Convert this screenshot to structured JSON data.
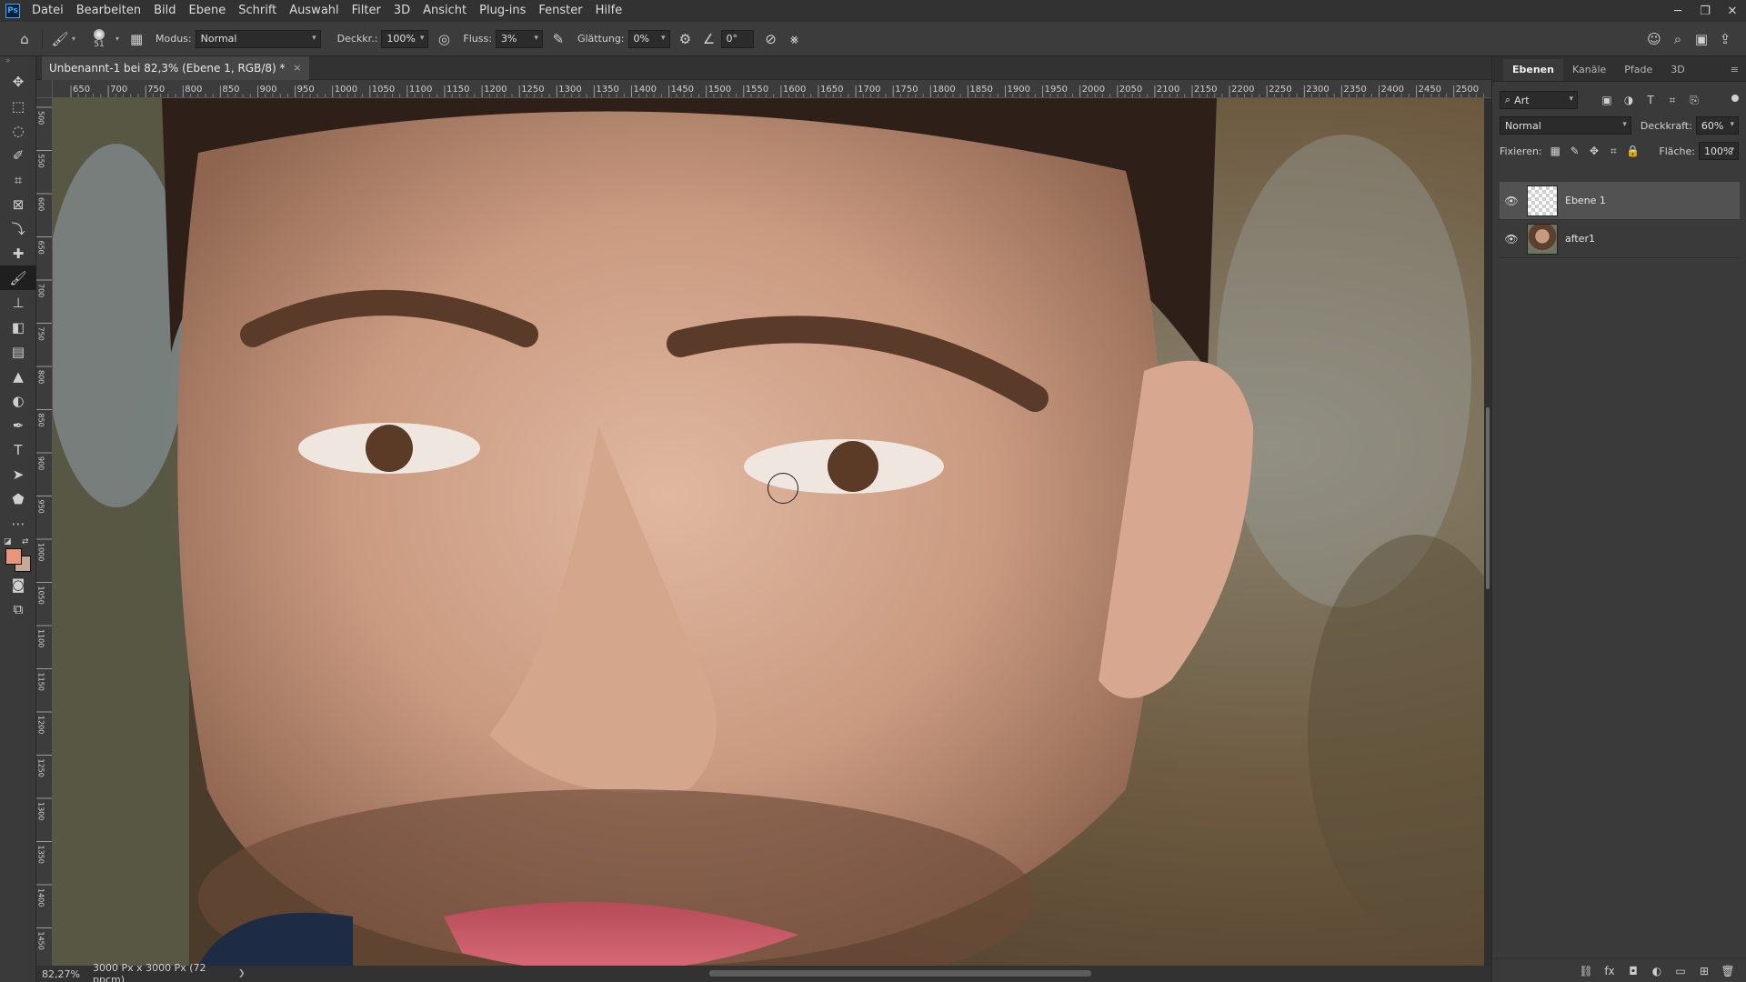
{
  "app": {
    "logo": "Ps",
    "menu": [
      "Datei",
      "Bearbeiten",
      "Bild",
      "Ebene",
      "Schrift",
      "Auswahl",
      "Filter",
      "3D",
      "Ansicht",
      "Plug-ins",
      "Fenster",
      "Hilfe"
    ],
    "window_controls": [
      "─",
      "❐",
      "✕"
    ]
  },
  "options": {
    "brush_size": "51",
    "modus_label": "Modus:",
    "modus_value": "Normal",
    "deckkr_label": "Deckkr.:",
    "deckkr_value": "100%",
    "fluss_label": "Fluss:",
    "fluss_value": "3%",
    "glaettung_label": "Glättung:",
    "glaettung_value": "0%",
    "angle_value": "0°"
  },
  "document": {
    "tab_title": "Unbenannt-1 bei 82,3% (Ebene 1, RGB/8) *",
    "close_glyph": "×"
  },
  "ruler": {
    "top_labels": [
      "650",
      "700",
      "750",
      "800",
      "850",
      "900",
      "950",
      "1000",
      "1050",
      "1100",
      "1150",
      "1200",
      "1250",
      "1300",
      "1350",
      "1400",
      "1450",
      "1500",
      "1550",
      "1600",
      "1650",
      "1700",
      "1750",
      "1800",
      "1850",
      "1900",
      "1950",
      "2000",
      "2050",
      "2100",
      "2150",
      "2200",
      "2250",
      "2300",
      "2350",
      "2400",
      "2450",
      "2500"
    ],
    "left_labels": [
      "500",
      "550",
      "600",
      "650",
      "700",
      "750",
      "800",
      "850",
      "900",
      "950",
      "1000",
      "1050",
      "1100",
      "1150",
      "1200",
      "1250",
      "1300",
      "1350",
      "1400",
      "1450"
    ]
  },
  "status": {
    "zoom": "82,27%",
    "doc_info": "3000 Px x 3000 Px (72 ppcm)",
    "arrow": "❯"
  },
  "panel": {
    "tabs": [
      "Ebenen",
      "Kanäle",
      "Pfade",
      "3D"
    ],
    "filter_value": "Art",
    "blend_mode": "Normal",
    "opacity_label": "Deckkraft:",
    "opacity_value": "60%",
    "lock_label": "Fixieren:",
    "fill_label": "Fläche:",
    "fill_value": "100%",
    "layers": [
      {
        "name": "Ebene 1",
        "active": true
      },
      {
        "name": "after1",
        "active": false
      }
    ]
  },
  "colors": {
    "foreground": "#e8967a",
    "background": "#c8a895",
    "accent": "#31a8ff"
  }
}
